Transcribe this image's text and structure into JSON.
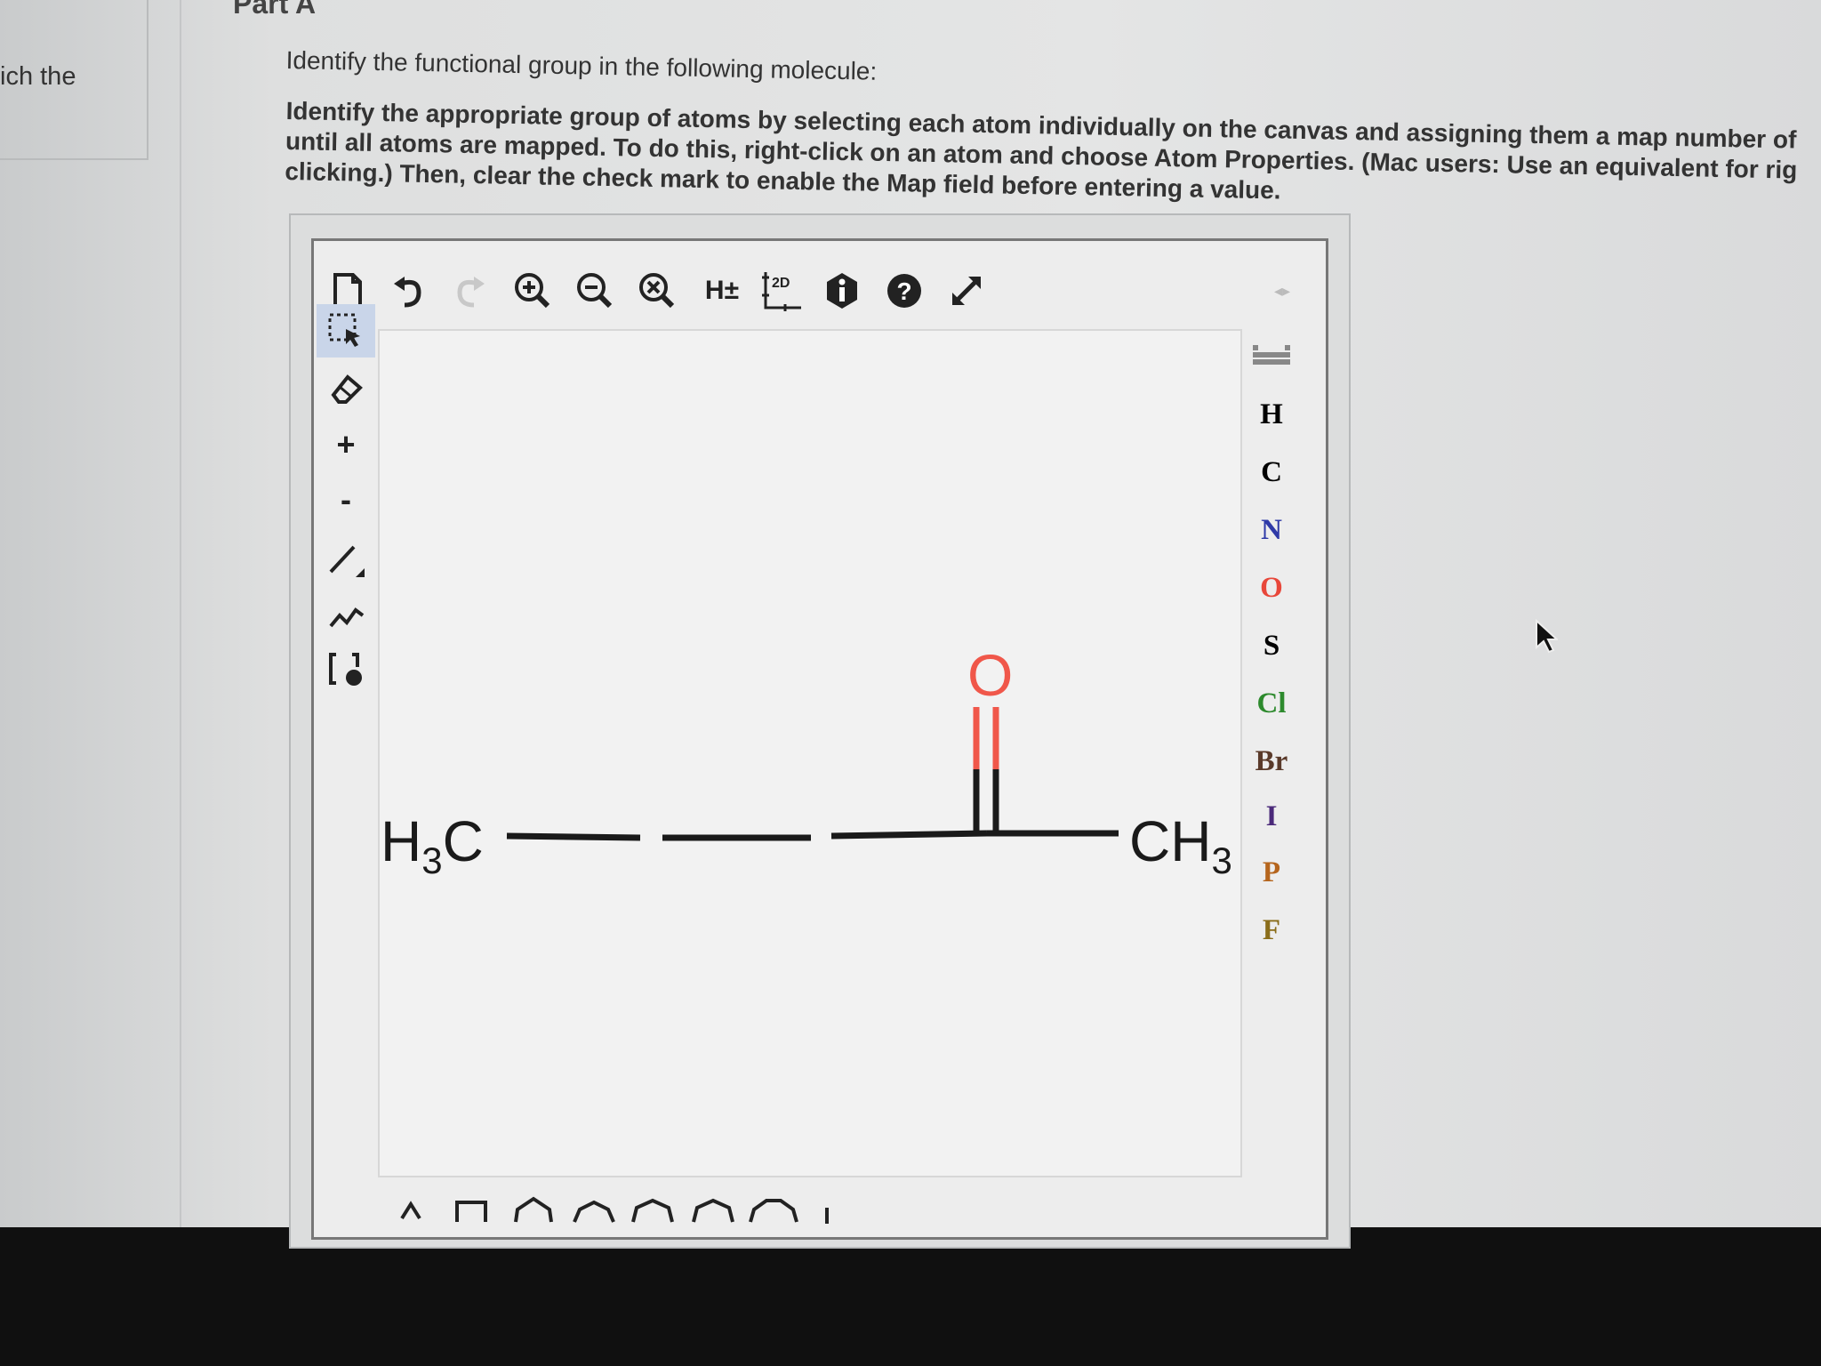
{
  "left_panel": {
    "text": "ich the"
  },
  "part_title": "Part A",
  "prompt": "Identify the functional group in the following molecule:",
  "instructions": [
    "Identify the appropriate group of atoms by selecting each atom individually on the canvas and assigning them a map number of",
    "until all atoms are mapped. To do this, right-click on an atom and choose Atom Properties. (Mac users: Use an equivalent for rig",
    "clicking.) Then, clear the check mark to enable the Map field before entering a value."
  ],
  "toolbar": {
    "h_label": "H±",
    "twod_label": "2D",
    "icons": [
      "new-document-icon",
      "undo-icon",
      "redo-icon",
      "zoom-in-icon",
      "zoom-out-icon",
      "zoom-reset-icon",
      "hydrogen-toggle-icon",
      "clean-2d-icon",
      "info-icon",
      "help-icon",
      "fullscreen-icon"
    ]
  },
  "left_tools": {
    "plus": "+",
    "minus": "-"
  },
  "elements": [
    {
      "symbol": "H",
      "color": "#333333"
    },
    {
      "symbol": "C",
      "color": "#333333"
    },
    {
      "symbol": "N",
      "color": "#2f3aa8"
    },
    {
      "symbol": "O",
      "color": "#e8473a"
    },
    {
      "symbol": "S",
      "color": "#333333"
    },
    {
      "symbol": "Cl",
      "color": "#2d8a2d"
    },
    {
      "symbol": "Br",
      "color": "#5a3a2a"
    },
    {
      "symbol": "I",
      "color": "#4b2a7a"
    },
    {
      "symbol": "P",
      "color": "#b5651d"
    },
    {
      "symbol": "F",
      "color": "#8a6d1a"
    }
  ],
  "molecule": {
    "left_group": "H",
    "left_sub": "3",
    "left_c": "C",
    "right_group": "CH",
    "right_sub": "3",
    "oxygen": "O",
    "oxygen_color": "#f0574a"
  }
}
